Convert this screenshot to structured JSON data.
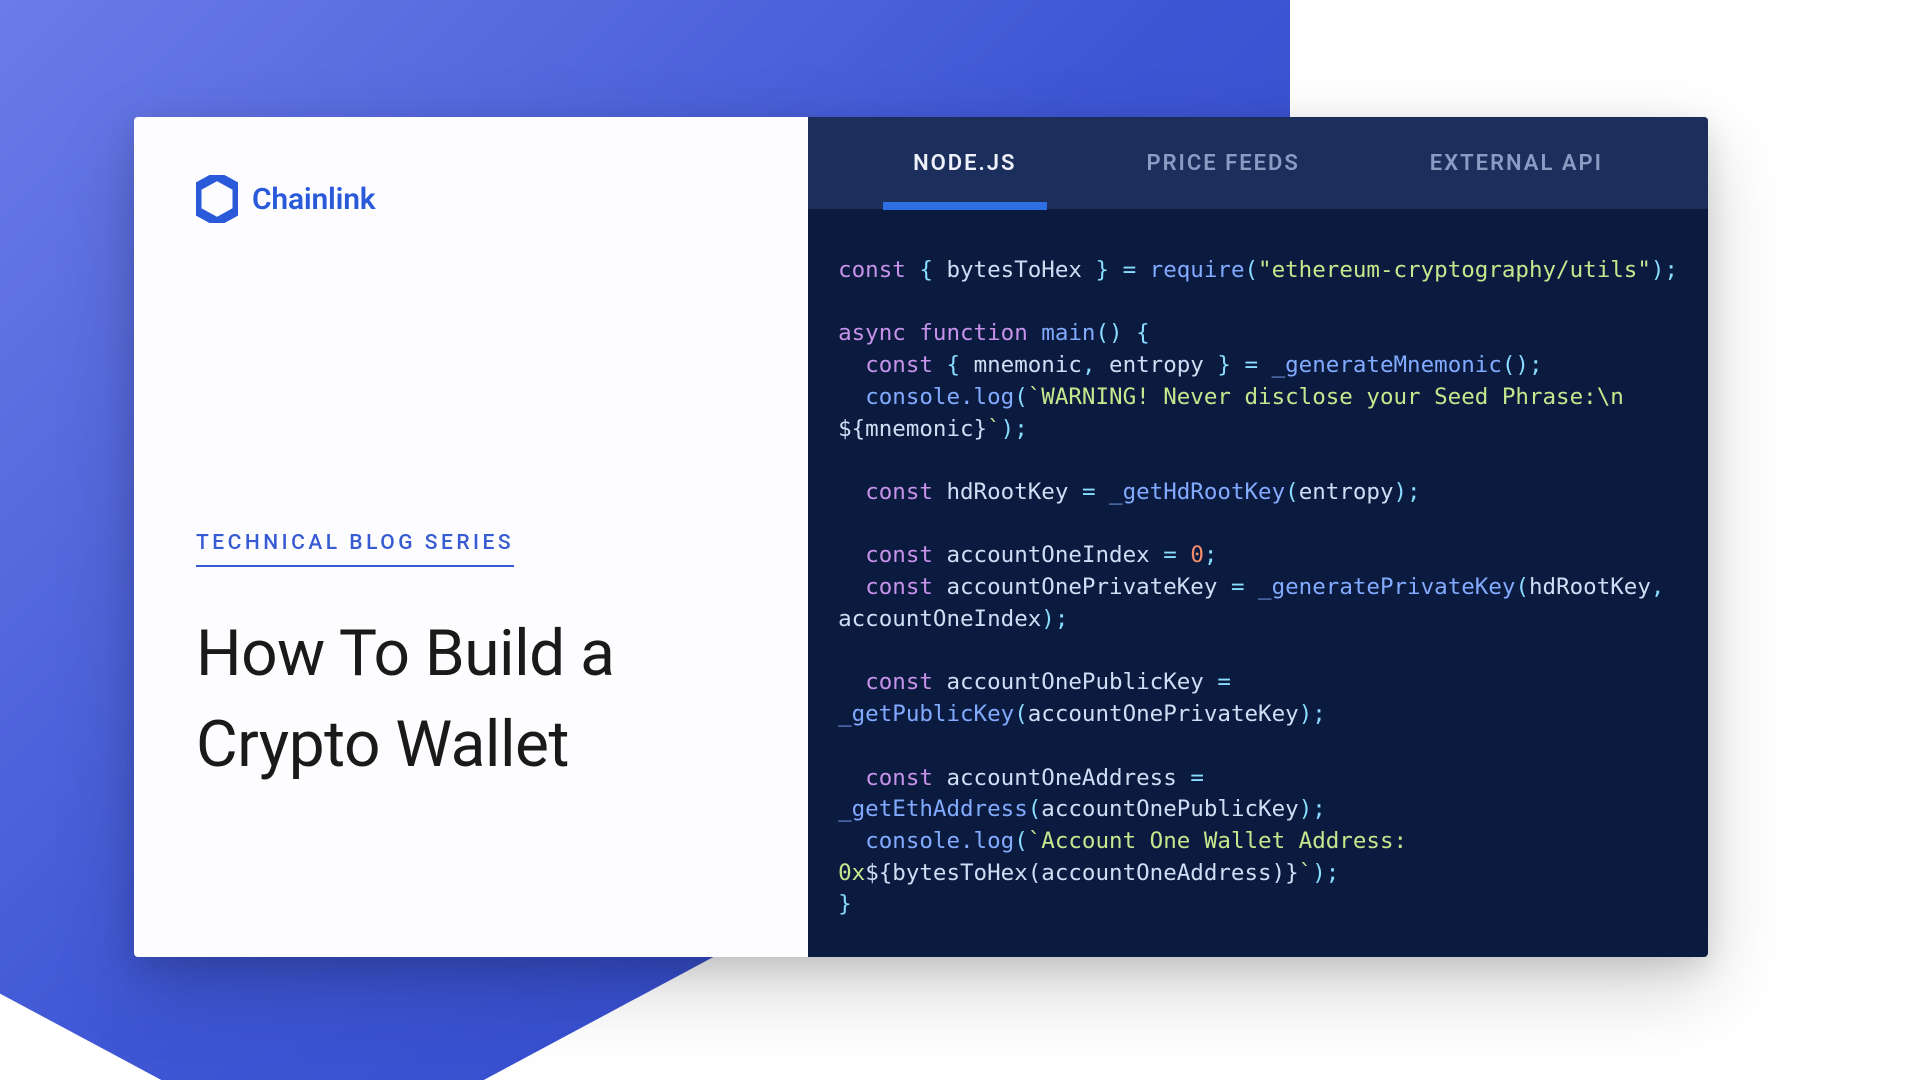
{
  "brand": {
    "name": "Chainlink",
    "color": "#2a5ada"
  },
  "series_label": "TECHNICAL BLOG SERIES",
  "title_line1": "How To Build a",
  "title_line2": "Crypto Wallet",
  "tabs": [
    {
      "label": "NODE.JS",
      "active": true
    },
    {
      "label": "PRICE FEEDS",
      "active": false
    },
    {
      "label": "EXTERNAL API",
      "active": false
    }
  ],
  "code": {
    "kw_const": "const",
    "kw_async": "async",
    "kw_function": "function",
    "kw_require": "require",
    "id_bytesToHex": "bytesToHex",
    "str_utils": "\"ethereum-cryptography/utils\"",
    "id_main": "main",
    "id_mnemonic": "mnemonic",
    "id_entropy": "entropy",
    "fn_generateMnemonic": "_generateMnemonic",
    "fn_consoleLog": "console.log",
    "tmpl_warn_a": "`WARNING! Never disclose your Seed Phrase:\\n ",
    "tmpl_warn_b": "`",
    "interp_mnemonic": "${mnemonic}",
    "id_hdRootKey": "hdRootKey",
    "fn_getHdRootKey": "_getHdRootKey",
    "id_accountOneIndex": "accountOneIndex",
    "num_zero": "0",
    "id_accountOnePrivateKey": "accountOnePrivateKey",
    "fn_generatePrivateKey": "_generatePrivateKey",
    "id_accountOnePublicKey": "accountOnePublicKey",
    "fn_getPublicKey": "_getPublicKey",
    "id_accountOneAddress": "accountOneAddress",
    "fn_getEthAddress": "_getEthAddress",
    "tmpl_addr_a": "`Account One Wallet Address: ",
    "tmpl_addr_b": "0x",
    "tmpl_addr_c": "`",
    "interp_addr": "${bytesToHex(accountOneAddress)}"
  }
}
